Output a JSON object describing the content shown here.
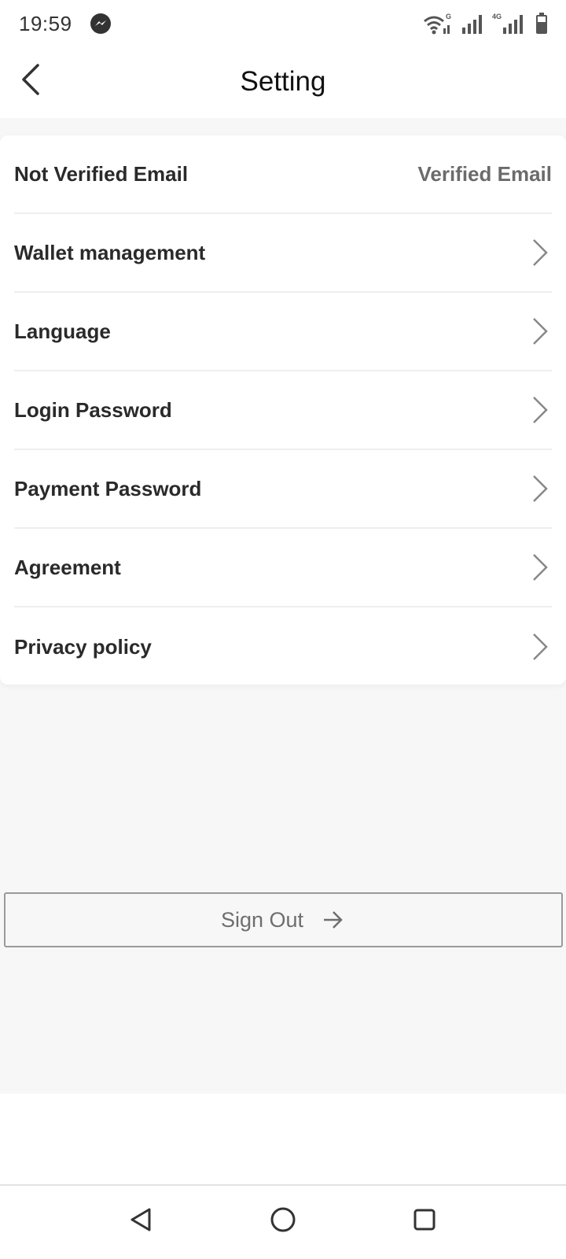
{
  "status_bar": {
    "time": "19:59",
    "notification_icon": "messenger-icon",
    "network_label_1": "G",
    "network_label_2": "4G",
    "icons": [
      "wifi-icon",
      "signal-icon",
      "signal-icon",
      "battery-icon"
    ]
  },
  "header": {
    "title": "Setting",
    "back_icon": "chevron-left-icon"
  },
  "settings": {
    "items": [
      {
        "label": "Not Verified Email",
        "value": "Verified Email",
        "icon": ""
      },
      {
        "label": "Wallet management",
        "icon": "chevron-right-icon"
      },
      {
        "label": "Language",
        "icon": "chevron-right-icon"
      },
      {
        "label": "Login Password",
        "icon": "chevron-right-icon"
      },
      {
        "label": "Payment Password",
        "icon": "chevron-right-icon"
      },
      {
        "label": "Agreement",
        "icon": "chevron-right-icon"
      },
      {
        "label": "Privacy policy",
        "icon": "chevron-right-icon"
      }
    ]
  },
  "sign_out": {
    "label": "Sign Out",
    "icon": "arrow-right-icon"
  },
  "nav_bar": {
    "icons": [
      "back-triangle-icon",
      "home-circle-icon",
      "recents-square-icon"
    ]
  },
  "colors": {
    "background": "#f7f7f7",
    "card": "#ffffff",
    "label_text": "#2a2a2a",
    "secondary_text": "#6b6b6b",
    "divider": "#eeeeee"
  }
}
